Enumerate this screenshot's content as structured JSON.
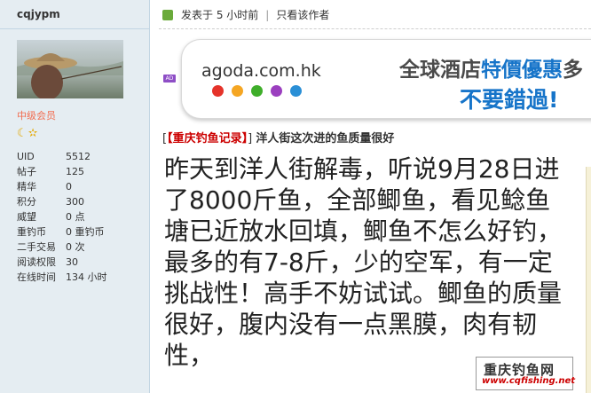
{
  "sidebar": {
    "username": "cqjypm",
    "level": "中级会员",
    "badges": "☾✫",
    "stats": [
      {
        "label": "UID",
        "value": "5512"
      },
      {
        "label": "帖子",
        "value": "125"
      },
      {
        "label": "精华",
        "value": "0"
      },
      {
        "label": "积分",
        "value": "300"
      },
      {
        "label": "威望",
        "value": "0 点"
      },
      {
        "label": "重钓币",
        "value": "0 重钓币"
      },
      {
        "label": "二手交易",
        "value": "0 次"
      },
      {
        "label": "阅读权限",
        "value": "30"
      },
      {
        "label": "在线时间",
        "value": "134 小时"
      }
    ]
  },
  "post": {
    "meta": {
      "posted": "发表于 5 小时前",
      "separator": "|",
      "only_author": "只看该作者"
    },
    "category": "【重庆钓鱼记录】",
    "title": "洋人街这次进的鱼质量很好",
    "body": [
      "昨天到洋人街解毒，听说",
      "9月28",
      "日进了",
      "8000",
      "斤鱼，全部鲫鱼，看见鲶鱼塘已近放水回填，鲫鱼不怎么好钓，最多的有",
      "7-8",
      "斤，少的空军，有一定挑战性！高手不妨试试。鲫鱼的质量很好，腹内没有一点黑膜，肉有韧性，"
    ]
  },
  "ad": {
    "label": "AD",
    "domain": "agoda.com.hk",
    "line1_part1": "全球酒店",
    "line1_highlight": "特價優惠",
    "line1_part2": "多",
    "line2": "不要錯過!",
    "dot_colors": [
      "#e5332a",
      "#f5a623",
      "#3fae2a",
      "#9b3fbf",
      "#2a8fd6"
    ]
  },
  "watermark": {
    "title": "重庆钓鱼网",
    "url": "www.cqfishing.net"
  },
  "colors": {
    "sidebar_bg": "#e5edf2",
    "level_text": "#f26c4f",
    "category": "#cc0000",
    "ad_blue": "#1674c9"
  }
}
